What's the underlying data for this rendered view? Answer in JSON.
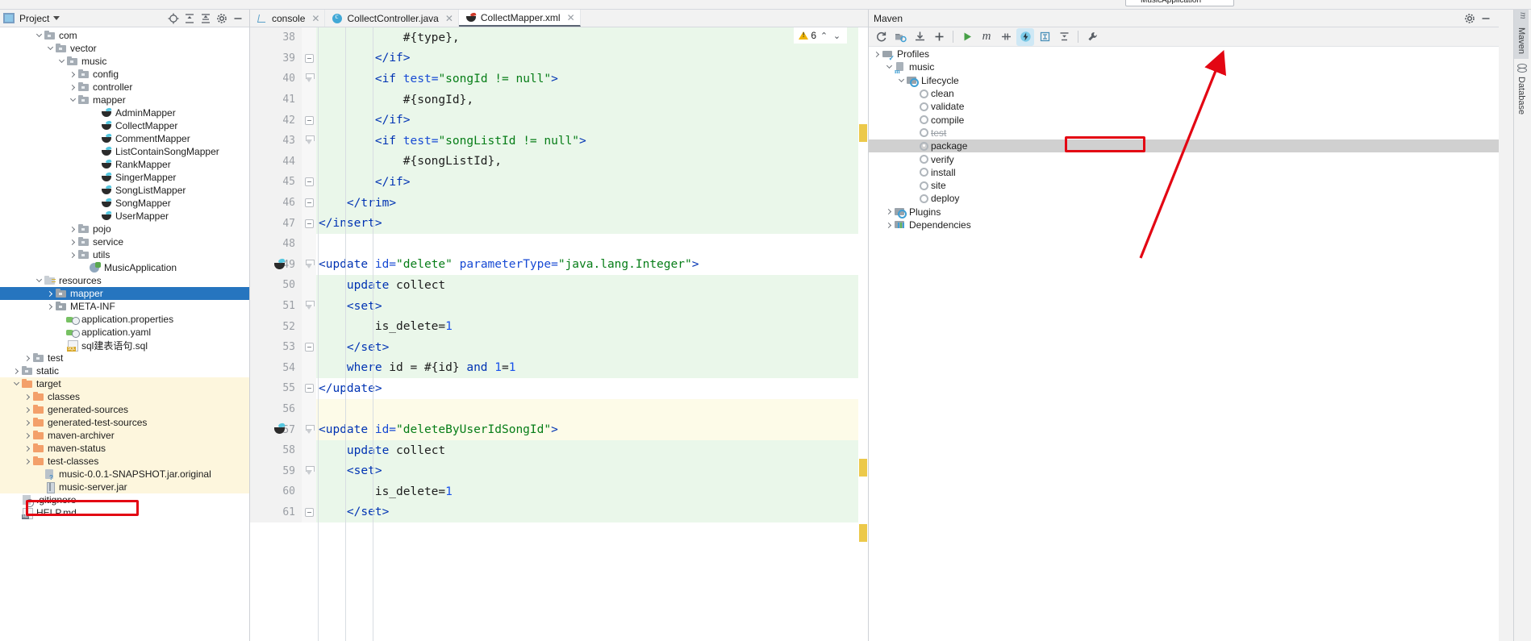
{
  "toolbar": {
    "run_config": "MusicApplication"
  },
  "project_panel": {
    "title": "Project",
    "icons": [
      "project-icon",
      "locate-icon",
      "expand-all-icon",
      "collapse-all-icon",
      "settings-icon",
      "hide-icon"
    ],
    "tree": [
      {
        "label": "com",
        "indent": 3,
        "arrow": "down",
        "icon": "folder-gray"
      },
      {
        "label": "vector",
        "indent": 4,
        "arrow": "down",
        "icon": "folder-gray"
      },
      {
        "label": "music",
        "indent": 5,
        "arrow": "down",
        "icon": "folder-gray"
      },
      {
        "label": "config",
        "indent": 6,
        "arrow": "right",
        "icon": "folder-gray"
      },
      {
        "label": "controller",
        "indent": 6,
        "arrow": "right",
        "icon": "folder-gray"
      },
      {
        "label": "mapper",
        "indent": 6,
        "arrow": "down",
        "icon": "folder-gray"
      },
      {
        "label": "AdminMapper",
        "indent": 8,
        "arrow": "none",
        "icon": "mybatis"
      },
      {
        "label": "CollectMapper",
        "indent": 8,
        "arrow": "none",
        "icon": "mybatis"
      },
      {
        "label": "CommentMapper",
        "indent": 8,
        "arrow": "none",
        "icon": "mybatis"
      },
      {
        "label": "ListContainSongMapper",
        "indent": 8,
        "arrow": "none",
        "icon": "mybatis"
      },
      {
        "label": "RankMapper",
        "indent": 8,
        "arrow": "none",
        "icon": "mybatis"
      },
      {
        "label": "SingerMapper",
        "indent": 8,
        "arrow": "none",
        "icon": "mybatis"
      },
      {
        "label": "SongListMapper",
        "indent": 8,
        "arrow": "none",
        "icon": "mybatis"
      },
      {
        "label": "SongMapper",
        "indent": 8,
        "arrow": "none",
        "icon": "mybatis"
      },
      {
        "label": "UserMapper",
        "indent": 8,
        "arrow": "none",
        "icon": "mybatis"
      },
      {
        "label": "pojo",
        "indent": 6,
        "arrow": "right",
        "icon": "folder-gray"
      },
      {
        "label": "service",
        "indent": 6,
        "arrow": "right",
        "icon": "folder-gray"
      },
      {
        "label": "utils",
        "indent": 6,
        "arrow": "right",
        "icon": "folder-gray"
      },
      {
        "label": "MusicApplication",
        "indent": 7,
        "arrow": "none",
        "icon": "spring-boot"
      },
      {
        "label": "resources",
        "indent": 3,
        "arrow": "down",
        "icon": "folder-resources"
      },
      {
        "label": "mapper",
        "indent": 4,
        "arrow": "right",
        "icon": "folder-blue",
        "selected": true
      },
      {
        "label": "META-INF",
        "indent": 4,
        "arrow": "right",
        "icon": "folder-blue"
      },
      {
        "label": "application.properties",
        "indent": 5,
        "arrow": "none",
        "icon": "properties"
      },
      {
        "label": "application.yaml",
        "indent": 5,
        "arrow": "none",
        "icon": "properties"
      },
      {
        "label": "sql建表语句.sql",
        "indent": 5,
        "arrow": "none",
        "icon": "sql"
      },
      {
        "label": "test",
        "indent": 2,
        "arrow": "right",
        "icon": "folder-gray"
      },
      {
        "label": "static",
        "indent": 1,
        "arrow": "right",
        "icon": "folder-gray"
      },
      {
        "label": "target",
        "indent": 1,
        "arrow": "down",
        "icon": "folder-orange",
        "highlight": true
      },
      {
        "label": "classes",
        "indent": 2,
        "arrow": "right",
        "icon": "folder-orange",
        "highlight": true
      },
      {
        "label": "generated-sources",
        "indent": 2,
        "arrow": "right",
        "icon": "folder-orange",
        "highlight": true
      },
      {
        "label": "generated-test-sources",
        "indent": 2,
        "arrow": "right",
        "icon": "folder-orange",
        "highlight": true
      },
      {
        "label": "maven-archiver",
        "indent": 2,
        "arrow": "right",
        "icon": "folder-orange",
        "highlight": true
      },
      {
        "label": "maven-status",
        "indent": 2,
        "arrow": "right",
        "icon": "folder-orange",
        "highlight": true
      },
      {
        "label": "test-classes",
        "indent": 2,
        "arrow": "right",
        "icon": "folder-orange",
        "highlight": true
      },
      {
        "label": "music-0.0.1-SNAPSHOT.jar.original",
        "indent": 3,
        "arrow": "none",
        "icon": "jar-original",
        "highlight": true
      },
      {
        "label": "music-server.jar",
        "indent": 3,
        "arrow": "none",
        "icon": "jar",
        "highlight": true,
        "annotated": true
      },
      {
        "label": ".gitignore",
        "indent": 1,
        "arrow": "none",
        "icon": "gitignore"
      },
      {
        "label": "HELP.md",
        "indent": 1,
        "arrow": "none",
        "icon": "markdown"
      }
    ]
  },
  "editor": {
    "tabs": [
      {
        "label": "console",
        "icon": "console-icon",
        "active": false,
        "closable": true
      },
      {
        "label": "CollectController.java",
        "icon": "java-class-icon",
        "active": false,
        "closable": true
      },
      {
        "label": "CollectMapper.xml",
        "icon": "mybatis-icon",
        "active": true,
        "closable": true
      }
    ],
    "inspection": {
      "warning_count": "6",
      "icon": "warning-triangle-icon"
    },
    "lines": [
      {
        "n": "38",
        "bg": "green",
        "fold": "none",
        "run": false,
        "tokens": [
          {
            "t": "            ",
            "c": "txt"
          },
          {
            "t": "#{type},",
            "c": "txt"
          }
        ]
      },
      {
        "n": "39",
        "bg": "green",
        "fold": "minus",
        "run": false,
        "tokens": [
          {
            "t": "        ",
            "c": "txt"
          },
          {
            "t": "</",
            "c": "tag"
          },
          {
            "t": "if",
            "c": "tag"
          },
          {
            "t": ">",
            "c": "tag"
          }
        ]
      },
      {
        "n": "40",
        "bg": "green",
        "fold": "tip",
        "run": false,
        "tokens": [
          {
            "t": "        ",
            "c": "txt"
          },
          {
            "t": "<",
            "c": "tag"
          },
          {
            "t": "if ",
            "c": "tag"
          },
          {
            "t": "test=",
            "c": "attr"
          },
          {
            "t": "\"songId != null\"",
            "c": "str"
          },
          {
            "t": ">",
            "c": "tag"
          }
        ]
      },
      {
        "n": "41",
        "bg": "green",
        "fold": "none",
        "run": false,
        "tokens": [
          {
            "t": "            ",
            "c": "txt"
          },
          {
            "t": "#{songId},",
            "c": "txt"
          }
        ]
      },
      {
        "n": "42",
        "bg": "green",
        "fold": "minus",
        "run": false,
        "tokens": [
          {
            "t": "        ",
            "c": "txt"
          },
          {
            "t": "</",
            "c": "tag"
          },
          {
            "t": "if",
            "c": "tag"
          },
          {
            "t": ">",
            "c": "tag"
          }
        ]
      },
      {
        "n": "43",
        "bg": "green",
        "fold": "tip",
        "run": false,
        "tokens": [
          {
            "t": "        ",
            "c": "txt"
          },
          {
            "t": "<",
            "c": "tag"
          },
          {
            "t": "if ",
            "c": "tag"
          },
          {
            "t": "test=",
            "c": "attr"
          },
          {
            "t": "\"songListId != null\"",
            "c": "str"
          },
          {
            "t": ">",
            "c": "tag"
          }
        ]
      },
      {
        "n": "44",
        "bg": "green",
        "fold": "none",
        "run": false,
        "tokens": [
          {
            "t": "            ",
            "c": "txt"
          },
          {
            "t": "#{songListId},",
            "c": "txt"
          }
        ]
      },
      {
        "n": "45",
        "bg": "green",
        "fold": "minus",
        "run": false,
        "tokens": [
          {
            "t": "        ",
            "c": "txt"
          },
          {
            "t": "</",
            "c": "tag"
          },
          {
            "t": "if",
            "c": "tag"
          },
          {
            "t": ">",
            "c": "tag"
          }
        ]
      },
      {
        "n": "46",
        "bg": "green",
        "fold": "minus",
        "run": false,
        "tokens": [
          {
            "t": "    ",
            "c": "txt"
          },
          {
            "t": "</",
            "c": "tag"
          },
          {
            "t": "trim",
            "c": "tag"
          },
          {
            "t": ">",
            "c": "tag"
          }
        ]
      },
      {
        "n": "47",
        "bg": "green",
        "fold": "minus",
        "run": false,
        "tokens": [
          {
            "t": "",
            "c": "txt"
          },
          {
            "t": "</",
            "c": "tag"
          },
          {
            "t": "insert",
            "c": "tag"
          },
          {
            "t": ">",
            "c": "tag"
          }
        ]
      },
      {
        "n": "48",
        "bg": "none",
        "fold": "none",
        "run": false,
        "tokens": []
      },
      {
        "n": "49",
        "bg": "none",
        "fold": "tip",
        "run": true,
        "tokens": [
          {
            "t": "<",
            "c": "tag"
          },
          {
            "t": "update ",
            "c": "tag"
          },
          {
            "t": "id=",
            "c": "attr"
          },
          {
            "t": "\"delete\"",
            "c": "str"
          },
          {
            "t": " ",
            "c": "txt"
          },
          {
            "t": "parameterType=",
            "c": "attr"
          },
          {
            "t": "\"java.lang.Integer\"",
            "c": "str"
          },
          {
            "t": ">",
            "c": "tag"
          }
        ]
      },
      {
        "n": "50",
        "bg": "green",
        "fold": "none",
        "run": false,
        "tokens": [
          {
            "t": "    ",
            "c": "txt"
          },
          {
            "t": "update",
            "c": "kw"
          },
          {
            "t": " collect",
            "c": "txt"
          }
        ]
      },
      {
        "n": "51",
        "bg": "green",
        "fold": "tip",
        "run": false,
        "tokens": [
          {
            "t": "    ",
            "c": "txt"
          },
          {
            "t": "<",
            "c": "tag"
          },
          {
            "t": "set",
            "c": "tag"
          },
          {
            "t": ">",
            "c": "tag"
          }
        ]
      },
      {
        "n": "52",
        "bg": "green",
        "fold": "none",
        "run": false,
        "tokens": [
          {
            "t": "        ",
            "c": "txt"
          },
          {
            "t": "is_delete=",
            "c": "txt"
          },
          {
            "t": "1",
            "c": "num"
          }
        ]
      },
      {
        "n": "53",
        "bg": "green",
        "fold": "minus",
        "run": false,
        "tokens": [
          {
            "t": "    ",
            "c": "txt"
          },
          {
            "t": "</",
            "c": "tag"
          },
          {
            "t": "set",
            "c": "tag"
          },
          {
            "t": ">",
            "c": "tag"
          }
        ]
      },
      {
        "n": "54",
        "bg": "green",
        "fold": "none",
        "run": false,
        "tokens": [
          {
            "t": "    ",
            "c": "txt"
          },
          {
            "t": "where",
            "c": "kw"
          },
          {
            "t": " id = #{id} ",
            "c": "txt"
          },
          {
            "t": "and",
            "c": "kw"
          },
          {
            "t": " ",
            "c": "txt"
          },
          {
            "t": "1",
            "c": "num"
          },
          {
            "t": "=",
            "c": "txt"
          },
          {
            "t": "1",
            "c": "num"
          }
        ]
      },
      {
        "n": "55",
        "bg": "none",
        "fold": "minus",
        "run": false,
        "tokens": [
          {
            "t": "</",
            "c": "tag"
          },
          {
            "t": "update",
            "c": "tag"
          },
          {
            "t": ">",
            "c": "tag"
          }
        ]
      },
      {
        "n": "56",
        "bg": "yellow",
        "fold": "none",
        "run": false,
        "tokens": []
      },
      {
        "n": "57",
        "bg": "yellow",
        "fold": "tip",
        "run": true,
        "tokens": [
          {
            "t": "<",
            "c": "tag"
          },
          {
            "t": "update ",
            "c": "tag"
          },
          {
            "t": "id=",
            "c": "attr"
          },
          {
            "t": "\"deleteByUserIdSongId\"",
            "c": "str"
          },
          {
            "t": ">",
            "c": "tag"
          }
        ]
      },
      {
        "n": "58",
        "bg": "green",
        "fold": "none",
        "run": false,
        "tokens": [
          {
            "t": "    ",
            "c": "txt"
          },
          {
            "t": "update",
            "c": "kw"
          },
          {
            "t": " collect",
            "c": "txt"
          }
        ]
      },
      {
        "n": "59",
        "bg": "green",
        "fold": "tip",
        "run": false,
        "tokens": [
          {
            "t": "    ",
            "c": "txt"
          },
          {
            "t": "<",
            "c": "tag"
          },
          {
            "t": "set",
            "c": "tag"
          },
          {
            "t": ">",
            "c": "tag"
          }
        ]
      },
      {
        "n": "60",
        "bg": "green",
        "fold": "none",
        "run": false,
        "tokens": [
          {
            "t": "        ",
            "c": "txt"
          },
          {
            "t": "is_delete=",
            "c": "txt"
          },
          {
            "t": "1",
            "c": "num"
          }
        ]
      },
      {
        "n": "61",
        "bg": "green",
        "fold": "minus",
        "run": false,
        "tokens": [
          {
            "t": "    ",
            "c": "txt"
          },
          {
            "t": "</",
            "c": "tag"
          },
          {
            "t": "set",
            "c": "tag"
          },
          {
            "t": ">",
            "c": "tag"
          }
        ]
      }
    ]
  },
  "maven": {
    "title": "Maven",
    "header_icons": [
      "settings-icon",
      "hide-icon"
    ],
    "toolbar": [
      {
        "name": "reload-icon"
      },
      {
        "name": "add-module-icon"
      },
      {
        "name": "download-sources-icon"
      },
      {
        "name": "add-icon"
      },
      {
        "name": "run-icon"
      },
      {
        "name": "execute-maven-goal-icon"
      },
      {
        "name": "toggle-skip-tests-icon"
      },
      {
        "name": "toggle-offline-icon"
      },
      {
        "name": "expand-all-icon"
      },
      {
        "name": "collapse-all-icon"
      },
      {
        "name": "settings-wrench-icon"
      }
    ],
    "tree": [
      {
        "label": "Profiles",
        "indent": 0,
        "arrow": "right",
        "icon": "profiles"
      },
      {
        "label": "music",
        "indent": 1,
        "arrow": "down",
        "icon": "maven-module"
      },
      {
        "label": "Lifecycle",
        "indent": 2,
        "arrow": "down",
        "icon": "lifecycle"
      },
      {
        "label": "clean",
        "indent": 3,
        "arrow": "none",
        "icon": "gear"
      },
      {
        "label": "validate",
        "indent": 3,
        "arrow": "none",
        "icon": "gear"
      },
      {
        "label": "compile",
        "indent": 3,
        "arrow": "none",
        "icon": "gear"
      },
      {
        "label": "test",
        "indent": 3,
        "arrow": "none",
        "icon": "gear",
        "struck": true
      },
      {
        "label": "package",
        "indent": 3,
        "arrow": "none",
        "icon": "gear",
        "selected": true,
        "annotated": true
      },
      {
        "label": "verify",
        "indent": 3,
        "arrow": "none",
        "icon": "gear"
      },
      {
        "label": "install",
        "indent": 3,
        "arrow": "none",
        "icon": "gear"
      },
      {
        "label": "site",
        "indent": 3,
        "arrow": "none",
        "icon": "gear"
      },
      {
        "label": "deploy",
        "indent": 3,
        "arrow": "none",
        "icon": "gear"
      },
      {
        "label": "Plugins",
        "indent": 1,
        "arrow": "right",
        "icon": "lifecycle"
      },
      {
        "label": "Dependencies",
        "indent": 1,
        "arrow": "right",
        "icon": "dependencies"
      }
    ]
  },
  "right_stripe": {
    "items": [
      {
        "label": "Maven",
        "icon": "maven-icon",
        "active": true
      },
      {
        "label": "Database",
        "icon": "database-icon",
        "active": false
      }
    ]
  },
  "annotations": {
    "arrow_color": "#e30613",
    "box_color": "#e30613"
  }
}
